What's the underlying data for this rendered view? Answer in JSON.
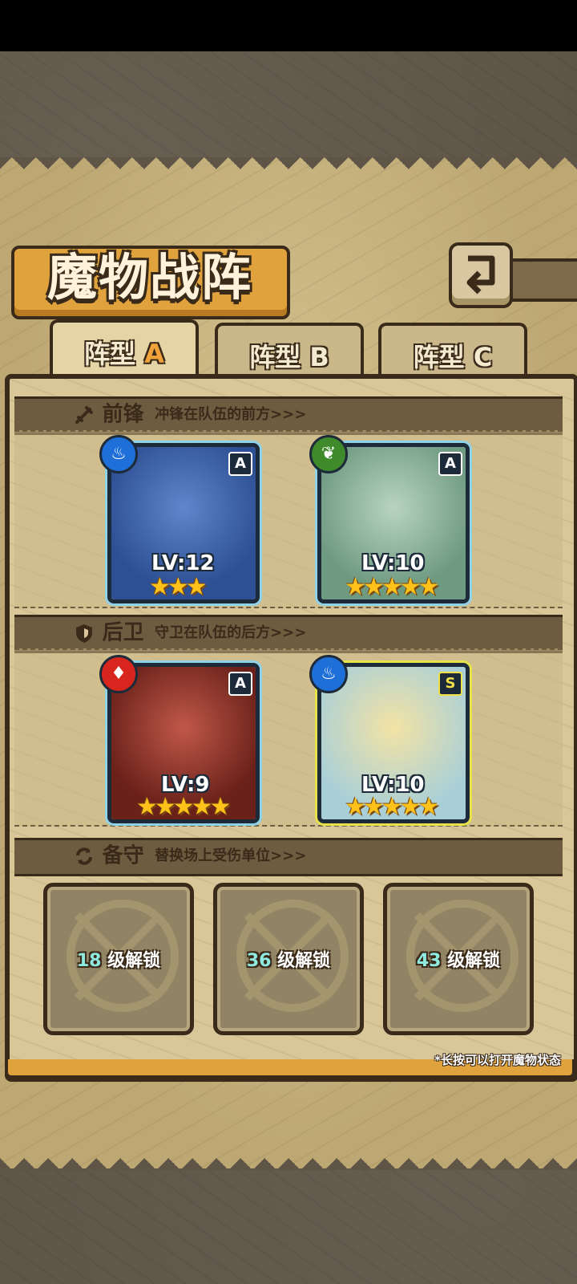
{
  "title": "魔物战阵",
  "tabs": [
    {
      "label": "阵型",
      "letter": "A",
      "active": true
    },
    {
      "label": "阵型",
      "letter": "B",
      "active": false
    },
    {
      "label": "阵型",
      "letter": "C",
      "active": false
    }
  ],
  "sections": {
    "front": {
      "title": "前锋",
      "desc": "冲锋在队伍的前方>>>"
    },
    "back": {
      "title": "后卫",
      "desc": "守卫在队伍的后方>>>"
    },
    "reserve": {
      "title": "备守",
      "desc": "替换场上受伤单位>>>"
    }
  },
  "cards": [
    {
      "element": "water",
      "element_color": "#1e6fd8",
      "rank": "A",
      "level": "LV:12",
      "stars": "★★★",
      "star_count": 3,
      "art_color": "#3a63b0"
    },
    {
      "element": "wood",
      "element_color": "#3f8a2a",
      "rank": "A",
      "level": "LV:10",
      "stars": "★★★★★",
      "star_count": 5,
      "art_color": "#8bb19a"
    },
    {
      "element": "fire",
      "element_color": "#d8261e",
      "rank": "A",
      "level": "LV:9",
      "stars": "★★★★★",
      "star_count": 5,
      "art_color": "#8a2e24"
    },
    {
      "element": "water",
      "element_color": "#1e6fd8",
      "rank": "S",
      "level": "LV:10",
      "stars": "★★★★★",
      "star_count": 5,
      "art_color": "#e9d27a"
    }
  ],
  "reserve_slots": [
    {
      "level": "18",
      "label": "级解锁"
    },
    {
      "level": "36",
      "label": "级解锁"
    },
    {
      "level": "43",
      "label": "级解锁"
    }
  ],
  "hint": "*长按可以打开魔物状态"
}
